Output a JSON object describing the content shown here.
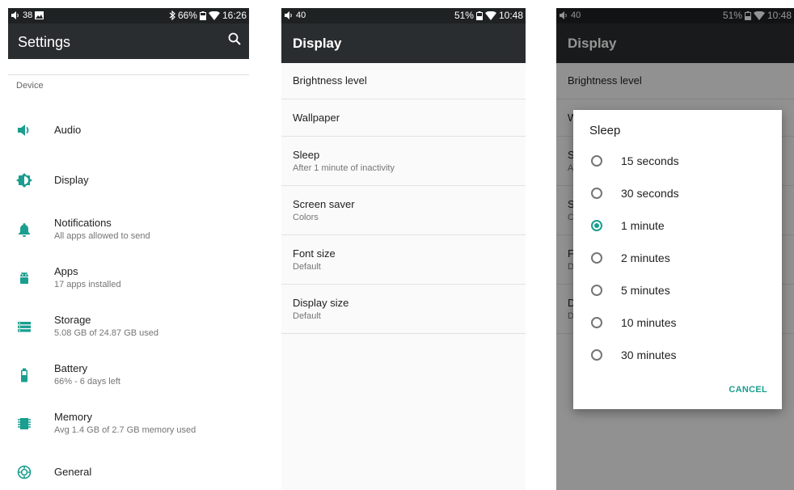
{
  "colors": {
    "accent": "#1a9e8f",
    "statusbar": "#1f2223",
    "appbar": "#2a2d2f"
  },
  "screen1": {
    "status": {
      "volume": "38",
      "battery": "66%",
      "time": "16:26"
    },
    "title": "Settings",
    "section": "Device",
    "items": [
      {
        "icon": "volume-icon",
        "title": "Audio",
        "subtitle": ""
      },
      {
        "icon": "brightness-icon",
        "title": "Display",
        "subtitle": ""
      },
      {
        "icon": "bell-icon",
        "title": "Notifications",
        "subtitle": "All apps allowed to send"
      },
      {
        "icon": "android-icon",
        "title": "Apps",
        "subtitle": "17 apps installed"
      },
      {
        "icon": "storage-icon",
        "title": "Storage",
        "subtitle": "5.08 GB of 24.87 GB used"
      },
      {
        "icon": "battery-icon",
        "title": "Battery",
        "subtitle": "66% - 6 days left"
      },
      {
        "icon": "memory-icon",
        "title": "Memory",
        "subtitle": "Avg 1.4 GB of 2.7 GB memory used"
      },
      {
        "icon": "gear-icon",
        "title": "General",
        "subtitle": ""
      }
    ]
  },
  "screen2": {
    "status": {
      "volume": "40",
      "battery": "51%",
      "time": "10:48"
    },
    "title": "Display",
    "rows": [
      {
        "title": "Brightness level",
        "subtitle": ""
      },
      {
        "title": "Wallpaper",
        "subtitle": ""
      },
      {
        "title": "Sleep",
        "subtitle": "After 1 minute of inactivity"
      },
      {
        "title": "Screen saver",
        "subtitle": "Colors"
      },
      {
        "title": "Font size",
        "subtitle": "Default"
      },
      {
        "title": "Display size",
        "subtitle": "Default"
      }
    ]
  },
  "screen3": {
    "status": {
      "volume": "40",
      "battery": "51%",
      "time": "10:48"
    },
    "title": "Display",
    "dialog": {
      "title": "Sleep",
      "options": [
        "15 seconds",
        "30 seconds",
        "1 minute",
        "2 minutes",
        "5 minutes",
        "10 minutes",
        "30 minutes"
      ],
      "selected": "1 minute",
      "cancel": "CANCEL"
    }
  }
}
